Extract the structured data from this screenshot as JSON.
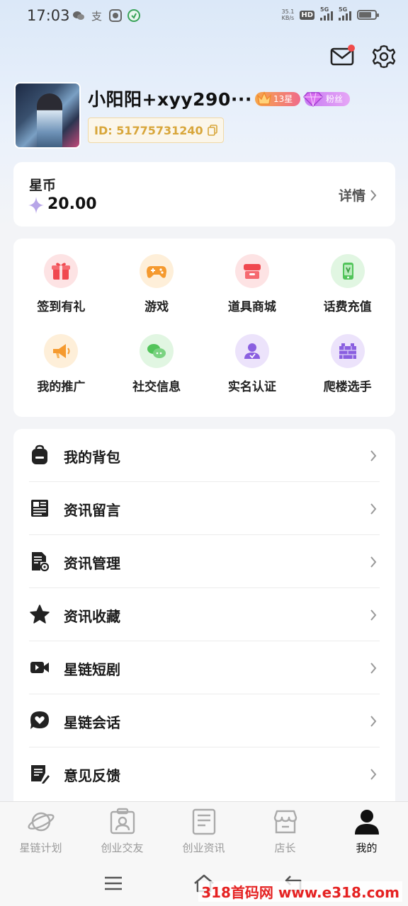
{
  "status_bar": {
    "time": "17:03",
    "net_speed_value": "35.1",
    "net_speed_unit": "KB/s",
    "network_1": "5G",
    "network_2": "5G",
    "hd_label": "HD",
    "battery_level": 0.75
  },
  "profile": {
    "username": "小阳阳+xyy290···",
    "level_badge": "13星",
    "fans_badge": "粉丝",
    "user_id": "ID: 51775731240"
  },
  "coins": {
    "title": "星币",
    "value": "20.00",
    "detail_label": "详情"
  },
  "features": [
    {
      "label": "签到有礼",
      "icon": "gift-icon",
      "color": "#f0484f",
      "bg": "#fde3e4"
    },
    {
      "label": "游戏",
      "icon": "gamepad-icon",
      "color": "#f59a2f",
      "bg": "#feefd9"
    },
    {
      "label": "道具商城",
      "icon": "shop-icon",
      "color": "#f0484f",
      "bg": "#fde3e4"
    },
    {
      "label": "话费充值",
      "icon": "phone-icon",
      "color": "#52c45a",
      "bg": "#e1f6e2"
    },
    {
      "label": "我的推广",
      "icon": "megaphone-icon",
      "color": "#f59a2f",
      "bg": "#feefd9"
    },
    {
      "label": "社交信息",
      "icon": "chat-icon",
      "color": "#52c45a",
      "bg": "#e1f6e2"
    },
    {
      "label": "实名认证",
      "icon": "user-verify-icon",
      "color": "#8a5fe0",
      "bg": "#ece3fb"
    },
    {
      "label": "爬楼选手",
      "icon": "wall-icon",
      "color": "#8a5fe0",
      "bg": "#ece3fb"
    }
  ],
  "menu": [
    {
      "label": "我的背包",
      "icon": "backpack-icon"
    },
    {
      "label": "资讯留言",
      "icon": "news-icon"
    },
    {
      "label": "资讯管理",
      "icon": "doc-settings-icon"
    },
    {
      "label": "资讯收藏",
      "icon": "star-icon"
    },
    {
      "label": "星链短剧",
      "icon": "video-icon"
    },
    {
      "label": "星链会话",
      "icon": "heart-chat-icon"
    },
    {
      "label": "意见反馈",
      "icon": "feedback-icon"
    }
  ],
  "bottom_nav": [
    {
      "label": "星链计划",
      "icon": "planet-icon",
      "active": false
    },
    {
      "label": "创业交友",
      "icon": "profile-card-icon",
      "active": false
    },
    {
      "label": "创业资讯",
      "icon": "newspaper-icon",
      "active": false
    },
    {
      "label": "店长",
      "icon": "store-icon",
      "active": false
    },
    {
      "label": "我的",
      "icon": "person-icon",
      "active": true
    }
  ],
  "watermark": {
    "brand": "318首码网",
    "url": "www.e318.com"
  }
}
